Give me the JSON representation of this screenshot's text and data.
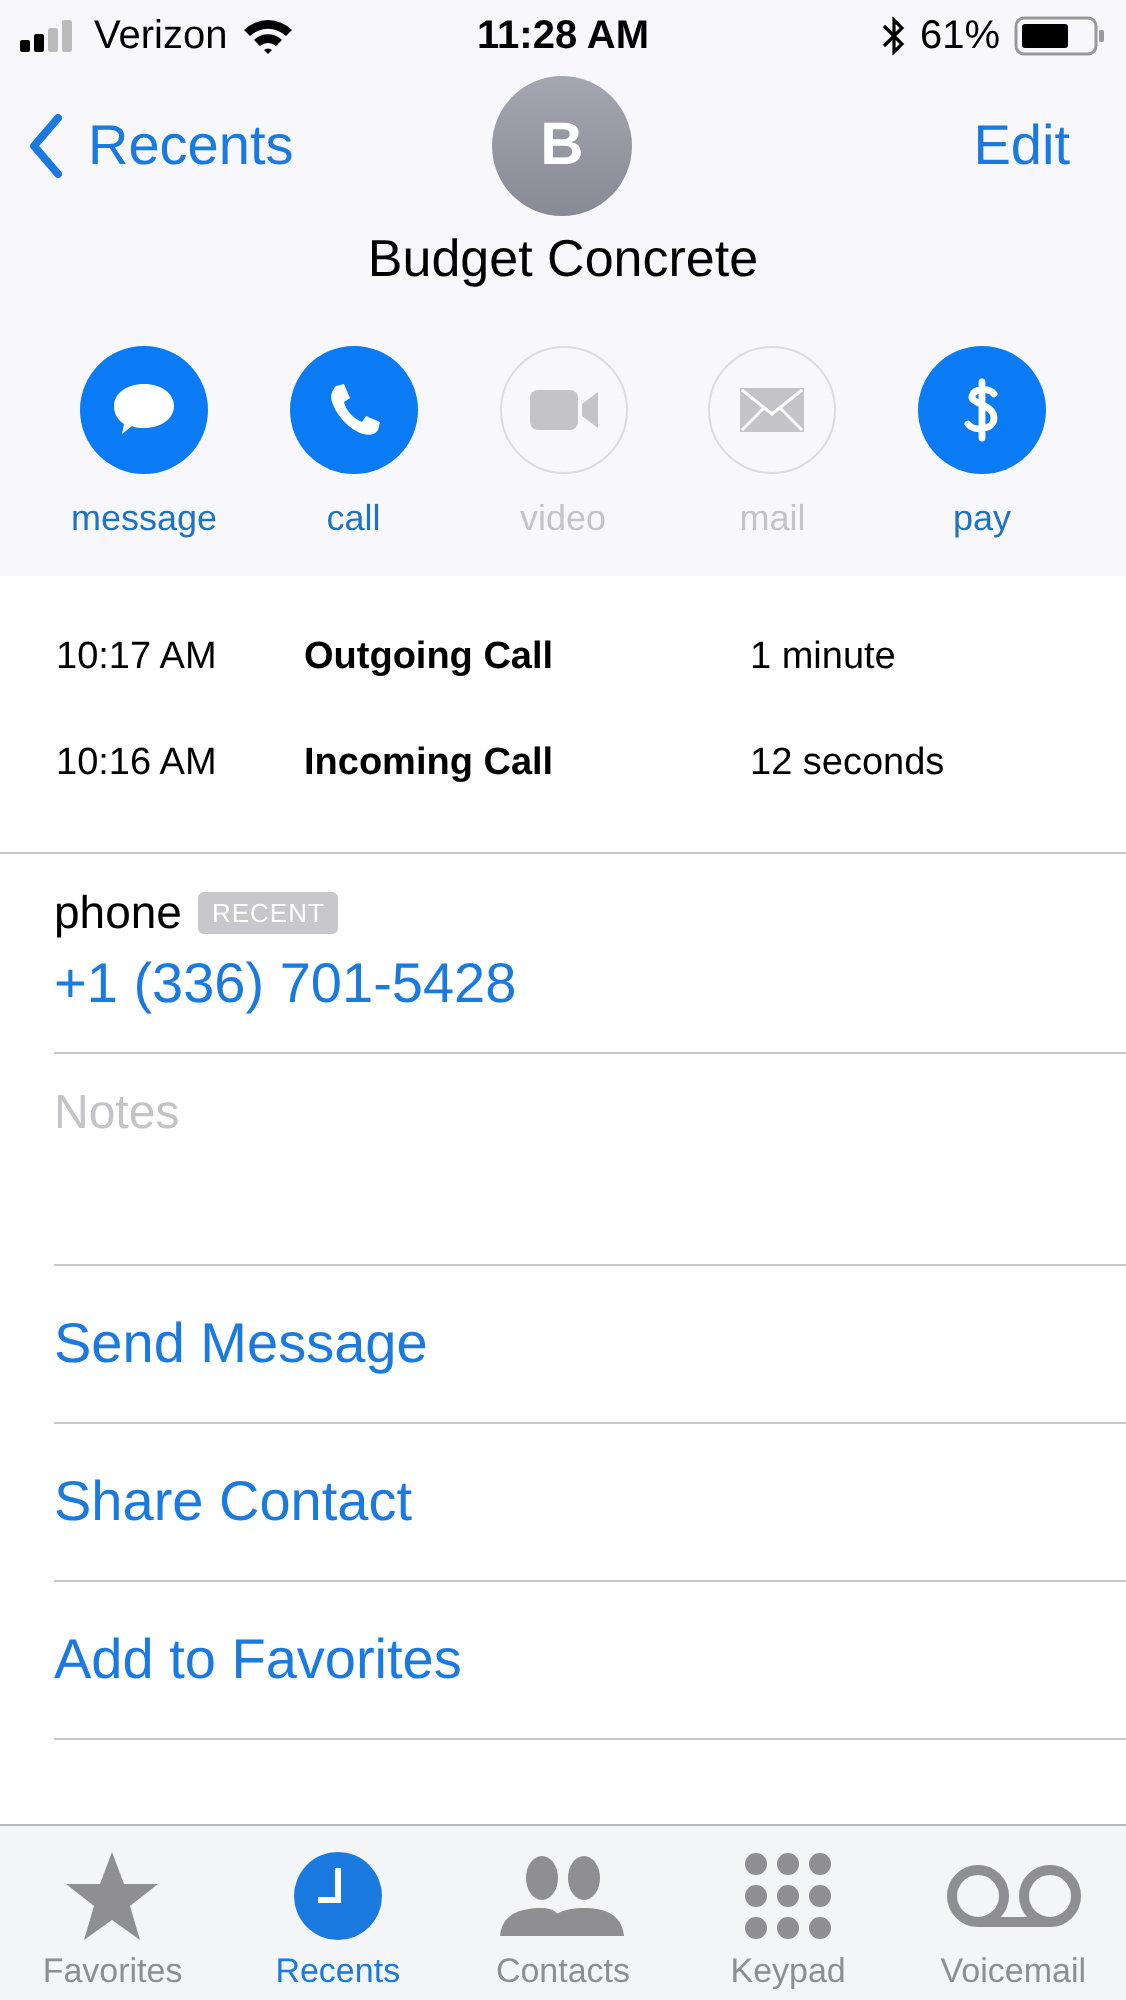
{
  "status_bar": {
    "carrier": "Verizon",
    "time": "11:28 AM",
    "battery": "61%"
  },
  "nav": {
    "back": "Recents",
    "edit": "Edit"
  },
  "contact": {
    "initial": "B",
    "name": "Budget Concrete"
  },
  "actions": [
    {
      "kind": "message",
      "label": "message",
      "disabled": false
    },
    {
      "kind": "call",
      "label": "call",
      "disabled": false
    },
    {
      "kind": "video",
      "label": "video",
      "disabled": true
    },
    {
      "kind": "mail",
      "label": "mail",
      "disabled": true
    },
    {
      "kind": "pay",
      "label": "pay",
      "disabled": false
    }
  ],
  "calls": [
    {
      "time": "10:17 AM",
      "type": "Outgoing Call",
      "duration": "1 minute"
    },
    {
      "time": "10:16 AM",
      "type": "Incoming Call",
      "duration": "12 seconds"
    }
  ],
  "phone": {
    "label": "phone",
    "badge": "RECENT",
    "number": "+1 (336) 701-5428"
  },
  "notes": {
    "placeholder": "Notes"
  },
  "links": [
    "Send Message",
    "Share Contact",
    "Add to Favorites"
  ],
  "tabs": [
    {
      "kind": "favorites",
      "label": "Favorites",
      "selected": false
    },
    {
      "kind": "recents",
      "label": "Recents",
      "selected": true
    },
    {
      "kind": "contacts",
      "label": "Contacts",
      "selected": false
    },
    {
      "kind": "keypad",
      "label": "Keypad",
      "selected": false
    },
    {
      "kind": "voicemail",
      "label": "Voicemail",
      "selected": false
    }
  ]
}
